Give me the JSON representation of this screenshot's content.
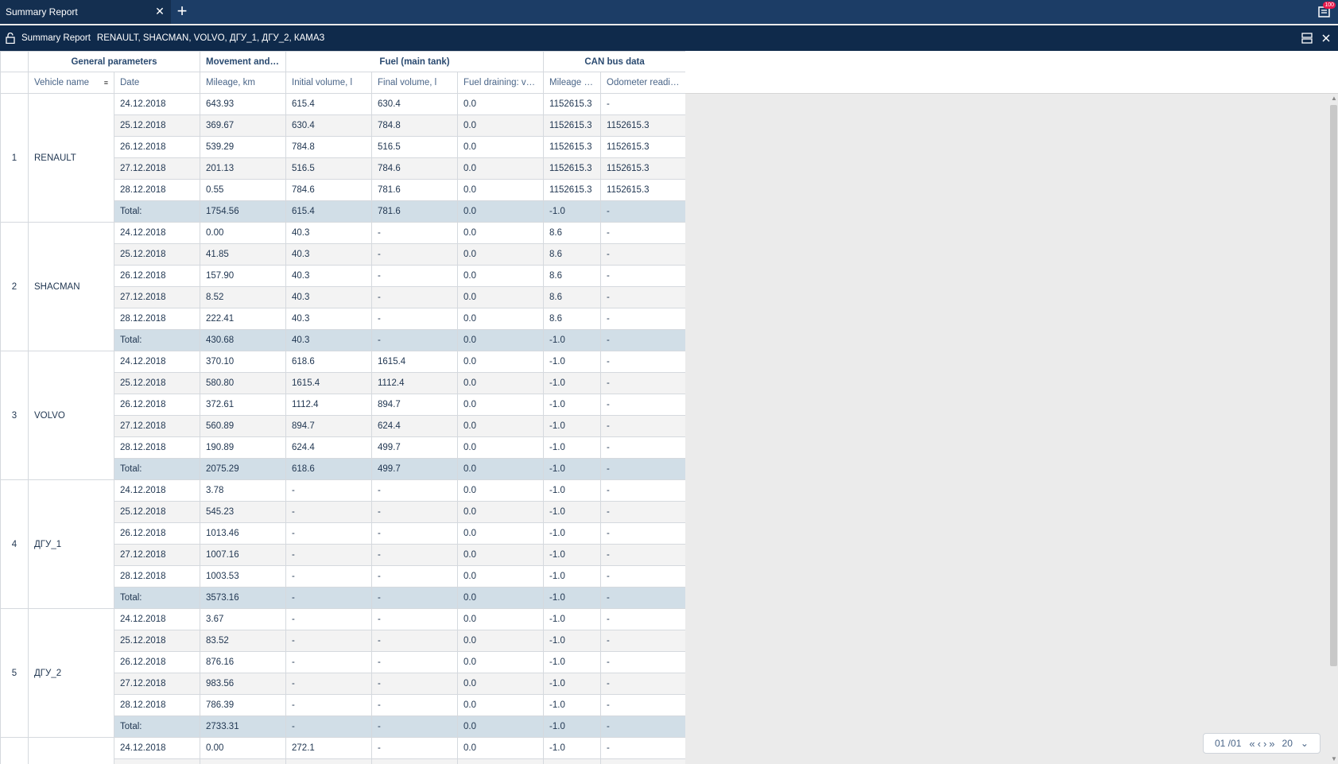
{
  "tab": {
    "title": "Summary Report",
    "close_glyph": "✕",
    "add_glyph": "+"
  },
  "notifications": {
    "badge": "100",
    "icon": "notifications-icon"
  },
  "title_bar": {
    "title": "Summary Report",
    "units": "RENAULT, SHACMAN, VOLVO, ДГУ_1, ДГУ_2, КАМАЗ"
  },
  "table": {
    "groups": [
      "General parameters",
      "Movement and ac...",
      "Fuel (main tank)",
      "CAN bus data"
    ],
    "columns": [
      "Vehicle name",
      "Date",
      "Mileage, km",
      "Initial volume, l",
      "Final volume, l",
      "Fuel draining: volu...",
      "Mileage at...",
      "Odometer reading..."
    ],
    "vehicles": [
      {
        "num": "1",
        "name": "RENAULT",
        "rows": [
          [
            "24.12.2018",
            "643.93",
            "615.4",
            "630.4",
            "0.0",
            "1152615.3",
            "-"
          ],
          [
            "25.12.2018",
            "369.67",
            "630.4",
            "784.8",
            "0.0",
            "1152615.3",
            "1152615.3"
          ],
          [
            "26.12.2018",
            "539.29",
            "784.8",
            "516.5",
            "0.0",
            "1152615.3",
            "1152615.3"
          ],
          [
            "27.12.2018",
            "201.13",
            "516.5",
            "784.6",
            "0.0",
            "1152615.3",
            "1152615.3"
          ],
          [
            "28.12.2018",
            "0.55",
            "784.6",
            "781.6",
            "0.0",
            "1152615.3",
            "1152615.3"
          ],
          [
            "Total:",
            "1754.56",
            "615.4",
            "781.6",
            "0.0",
            "-1.0",
            "-"
          ]
        ]
      },
      {
        "num": "2",
        "name": "SHACMAN",
        "rows": [
          [
            "24.12.2018",
            "0.00",
            "40.3",
            "-",
            "0.0",
            "8.6",
            "-"
          ],
          [
            "25.12.2018",
            "41.85",
            "40.3",
            "-",
            "0.0",
            "8.6",
            "-"
          ],
          [
            "26.12.2018",
            "157.90",
            "40.3",
            "-",
            "0.0",
            "8.6",
            "-"
          ],
          [
            "27.12.2018",
            "8.52",
            "40.3",
            "-",
            "0.0",
            "8.6",
            "-"
          ],
          [
            "28.12.2018",
            "222.41",
            "40.3",
            "-",
            "0.0",
            "8.6",
            "-"
          ],
          [
            "Total:",
            "430.68",
            "40.3",
            "-",
            "0.0",
            "-1.0",
            "-"
          ]
        ]
      },
      {
        "num": "3",
        "name": "VOLVO",
        "rows": [
          [
            "24.12.2018",
            "370.10",
            "618.6",
            "1615.4",
            "0.0",
            "-1.0",
            "-"
          ],
          [
            "25.12.2018",
            "580.80",
            "1615.4",
            "1112.4",
            "0.0",
            "-1.0",
            "-"
          ],
          [
            "26.12.2018",
            "372.61",
            "1112.4",
            "894.7",
            "0.0",
            "-1.0",
            "-"
          ],
          [
            "27.12.2018",
            "560.89",
            "894.7",
            "624.4",
            "0.0",
            "-1.0",
            "-"
          ],
          [
            "28.12.2018",
            "190.89",
            "624.4",
            "499.7",
            "0.0",
            "-1.0",
            "-"
          ],
          [
            "Total:",
            "2075.29",
            "618.6",
            "499.7",
            "0.0",
            "-1.0",
            "-"
          ]
        ]
      },
      {
        "num": "4",
        "name": "ДГУ_1",
        "rows": [
          [
            "24.12.2018",
            "3.78",
            "-",
            "-",
            "0.0",
            "-1.0",
            "-"
          ],
          [
            "25.12.2018",
            "545.23",
            "-",
            "-",
            "0.0",
            "-1.0",
            "-"
          ],
          [
            "26.12.2018",
            "1013.46",
            "-",
            "-",
            "0.0",
            "-1.0",
            "-"
          ],
          [
            "27.12.2018",
            "1007.16",
            "-",
            "-",
            "0.0",
            "-1.0",
            "-"
          ],
          [
            "28.12.2018",
            "1003.53",
            "-",
            "-",
            "0.0",
            "-1.0",
            "-"
          ],
          [
            "Total:",
            "3573.16",
            "-",
            "-",
            "0.0",
            "-1.0",
            "-"
          ]
        ]
      },
      {
        "num": "5",
        "name": "ДГУ_2",
        "rows": [
          [
            "24.12.2018",
            "3.67",
            "-",
            "-",
            "0.0",
            "-1.0",
            "-"
          ],
          [
            "25.12.2018",
            "83.52",
            "-",
            "-",
            "0.0",
            "-1.0",
            "-"
          ],
          [
            "26.12.2018",
            "876.16",
            "-",
            "-",
            "0.0",
            "-1.0",
            "-"
          ],
          [
            "27.12.2018",
            "983.56",
            "-",
            "-",
            "0.0",
            "-1.0",
            "-"
          ],
          [
            "28.12.2018",
            "786.39",
            "-",
            "-",
            "0.0",
            "-1.0",
            "-"
          ],
          [
            "Total:",
            "2733.31",
            "-",
            "-",
            "0.0",
            "-1.0",
            "-"
          ]
        ]
      },
      {
        "num": "",
        "name": "",
        "rows": [
          [
            "24.12.2018",
            "0.00",
            "272.1",
            "-",
            "0.0",
            "-1.0",
            "-"
          ],
          [
            "",
            "",
            "",
            "",
            "",
            "",
            ""
          ]
        ]
      }
    ]
  },
  "pager": {
    "page": "01 /01",
    "first": "«",
    "prev": "‹",
    "next": "›",
    "last": "»",
    "page_size": "20",
    "dropdown": "⌄"
  },
  "colors": {
    "tabbar": "#1c3d66",
    "titlebar": "#0f2a4b",
    "total_row": "#d1dee7",
    "alt_row": "#f3f3f3"
  }
}
